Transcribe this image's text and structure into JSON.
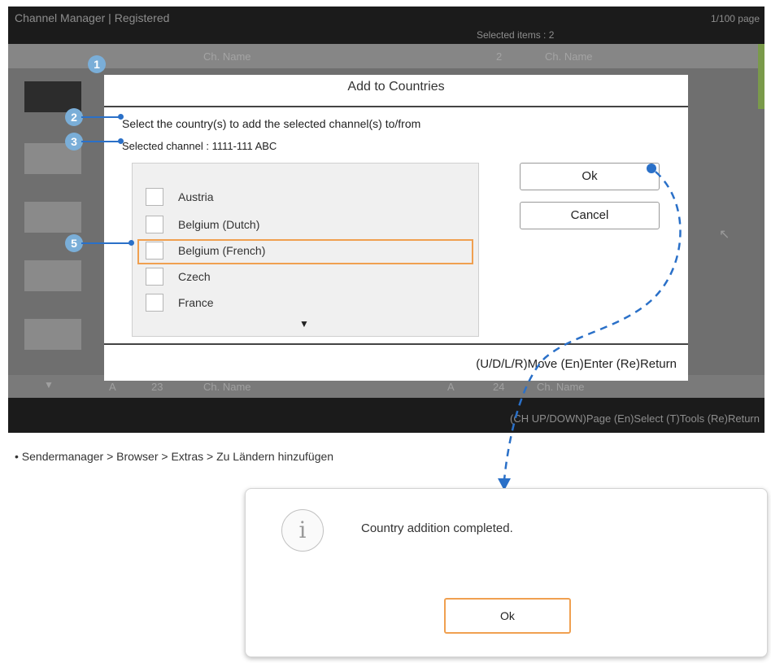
{
  "tv_screen": {
    "title": "Channel Manager | Registered",
    "page_indicator": "1/100 page",
    "selected_items": "Selected items : 2",
    "col_headers": [
      "Ch. Name",
      "2",
      "Ch. Name"
    ],
    "last_row": [
      "A",
      "23",
      "Ch. Name",
      "A",
      "24",
      "Ch. Name"
    ],
    "bottom_hints": "(CH UP/DOWN)Page (En)Select (T)Tools (Re)Return"
  },
  "dialog": {
    "title": "Add to Countries",
    "instruction": "Select the country(s) to add the selected channel(s) to/from",
    "selected_channel": "Selected channel : 1111-111 ABC",
    "countries": [
      "Austria",
      "Belgium (Dutch)",
      "Belgium (French)",
      "Czech",
      "France"
    ],
    "ok_label": "Ok",
    "cancel_label": "Cancel",
    "nav_hints": "(U/D/L/R)Move (En)Enter (Re)Return"
  },
  "markers": [
    "1",
    "2",
    "3",
    "5"
  ],
  "breadcrumb": "• Sendermanager > Browser > Extras > Zu Ländern hinzufügen",
  "popup": {
    "icon_glyph": "i",
    "message": "Country addition completed.",
    "ok_label": "Ok"
  },
  "colors": {
    "accent_orange": "#f0a050",
    "leader_blue": "#2a70c8",
    "marker_blue": "#7aaed8"
  },
  "icons": [
    "info-icon",
    "scroll-down-arrow-icon",
    "pointer-icon"
  ]
}
